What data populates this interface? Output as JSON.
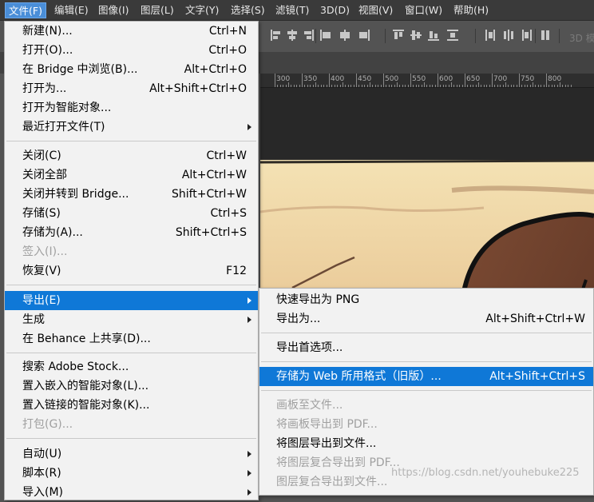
{
  "menubar": {
    "items": [
      {
        "label": "文件(F)",
        "active": true
      },
      {
        "label": "编辑(E)"
      },
      {
        "label": "图像(I)"
      },
      {
        "label": "图层(L)"
      },
      {
        "label": "文字(Y)"
      },
      {
        "label": "选择(S)"
      },
      {
        "label": "滤镜(T)"
      },
      {
        "label": "3D(D)"
      },
      {
        "label": "视图(V)"
      },
      {
        "label": "窗口(W)"
      },
      {
        "label": "帮助(H)"
      }
    ]
  },
  "toolbar": {
    "mode_3d_label": "3D 模"
  },
  "ruler": {
    "labels": [
      "300",
      "350",
      "400",
      "450",
      "500",
      "550",
      "600",
      "650",
      "700",
      "750",
      "800"
    ]
  },
  "file_menu": {
    "items": [
      {
        "label": "新建(N)...",
        "shortcut": "Ctrl+N"
      },
      {
        "label": "打开(O)...",
        "shortcut": "Ctrl+O"
      },
      {
        "label": "在 Bridge 中浏览(B)...",
        "shortcut": "Alt+Ctrl+O"
      },
      {
        "label": "打开为...",
        "shortcut": "Alt+Shift+Ctrl+O"
      },
      {
        "label": "打开为智能对象...",
        "shortcut": ""
      },
      {
        "label": "最近打开文件(T)",
        "shortcut": ""
      },
      {
        "label": "关闭(C)",
        "shortcut": "Ctrl+W"
      },
      {
        "label": "关闭全部",
        "shortcut": "Alt+Ctrl+W"
      },
      {
        "label": "关闭并转到 Bridge...",
        "shortcut": "Shift+Ctrl+W"
      },
      {
        "label": "存储(S)",
        "shortcut": "Ctrl+S"
      },
      {
        "label": "存储为(A)...",
        "shortcut": "Shift+Ctrl+S"
      },
      {
        "label": "签入(I)...",
        "shortcut": ""
      },
      {
        "label": "恢复(V)",
        "shortcut": "F12"
      },
      {
        "label": "导出(E)",
        "shortcut": ""
      },
      {
        "label": "生成",
        "shortcut": ""
      },
      {
        "label": "在 Behance 上共享(D)...",
        "shortcut": ""
      },
      {
        "label": "搜索 Adobe Stock...",
        "shortcut": ""
      },
      {
        "label": "置入嵌入的智能对象(L)...",
        "shortcut": ""
      },
      {
        "label": "置入链接的智能对象(K)...",
        "shortcut": ""
      },
      {
        "label": "打包(G)...",
        "shortcut": ""
      },
      {
        "label": "自动(U)",
        "shortcut": ""
      },
      {
        "label": "脚本(R)",
        "shortcut": ""
      },
      {
        "label": "导入(M)",
        "shortcut": ""
      }
    ]
  },
  "export_submenu": {
    "items": [
      {
        "label": "快速导出为 PNG",
        "shortcut": ""
      },
      {
        "label": "导出为...",
        "shortcut": "Alt+Shift+Ctrl+W"
      },
      {
        "label": "导出首选项...",
        "shortcut": ""
      },
      {
        "label": "存储为 Web 所用格式（旧版）...",
        "shortcut": "Alt+Shift+Ctrl+S"
      },
      {
        "label": "画板至文件...",
        "shortcut": ""
      },
      {
        "label": "将画板导出到 PDF...",
        "shortcut": ""
      },
      {
        "label": "将图层导出到文件...",
        "shortcut": ""
      },
      {
        "label": "将图层复合导出到 PDF...",
        "shortcut": ""
      },
      {
        "label": "图层复合导出到文件...",
        "shortcut": ""
      }
    ]
  },
  "watermark": "https://blog.csdn.net/youhebuke225",
  "colors": {
    "menu_highlight": "#0f78d7",
    "menubar_active": "#4a8ed8"
  }
}
